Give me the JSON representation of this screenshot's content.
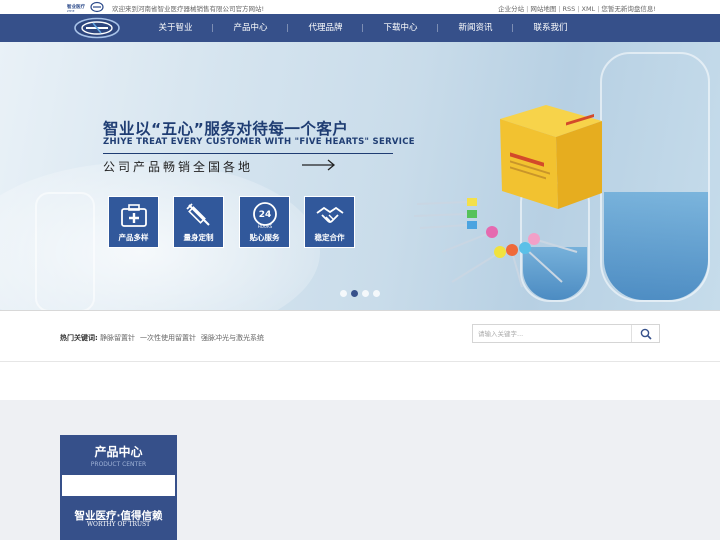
{
  "topbar": {
    "welcome": "欢迎来到河南省智业医疗器械销售有限公司官方网站!",
    "links": [
      "企业分站",
      "网站地图",
      "RSS",
      "XML"
    ],
    "notice": "您暂无新询盘信息!"
  },
  "nav": {
    "items": [
      "关于智业",
      "产品中心",
      "代理品牌",
      "下载中心",
      "新闻资讯",
      "联系我们"
    ]
  },
  "banner": {
    "title_cn": "智业以“五心”服务对待每一个客户",
    "title_en": "ZHIYE TREAT EVERY CUSTOMER WITH \"FIVE HEARTS\" SERVICE",
    "subtitle": "公司产品畅销全国各地",
    "features": [
      {
        "label": "产品多样",
        "icon": "medical-kit-icon"
      },
      {
        "label": "量身定制",
        "icon": "syringe-icon"
      },
      {
        "label": "贴心服务",
        "icon": "24-hours-icon"
      },
      {
        "label": "稳定合作",
        "icon": "handshake-icon"
      }
    ],
    "slides": 4,
    "active_slide": 2
  },
  "hot": {
    "label": "热门关键词:",
    "keywords": [
      "静脉留置针",
      "一次性使用留置针",
      "强脉冲光与激光系统"
    ]
  },
  "search": {
    "placeholder": "请输入关键字..."
  },
  "product_center": {
    "title": "产品中心",
    "subtitle": "PRODUCT CENTER",
    "slogan": "智业医疗·值得信赖",
    "slogan_en": "WORTHY OF TRUST"
  },
  "colors": {
    "brand": "#36508a",
    "feature": "#31589b",
    "heading": "#1f3d73"
  }
}
